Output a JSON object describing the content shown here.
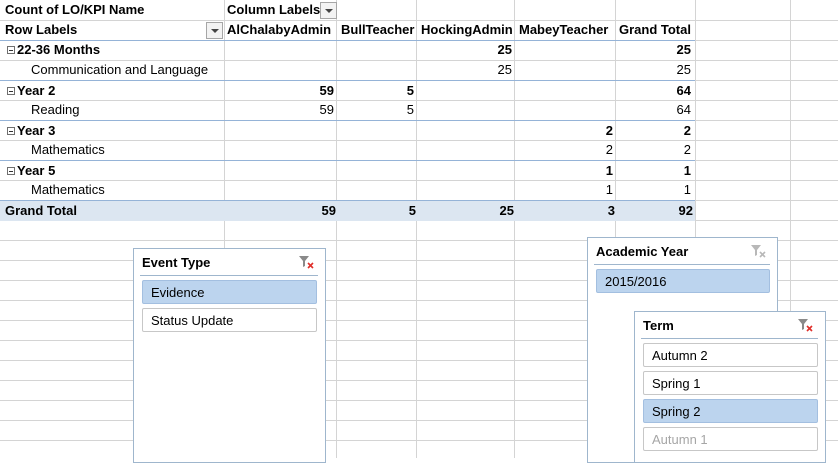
{
  "pivot": {
    "value_header": "Count of LO/KPI Name",
    "column_labels": "Column Labels",
    "row_labels": "Row Labels",
    "columns": [
      "AlChalabyAdmin",
      "BullTeacher",
      "HockingAdmin",
      "MabeyTeacher",
      "Grand Total"
    ],
    "rows": [
      {
        "label": "22-36 Months",
        "level": 0,
        "values": [
          "",
          "",
          "25",
          "",
          "25"
        ]
      },
      {
        "label": "Communication and Language",
        "level": 1,
        "values": [
          "",
          "",
          "25",
          "",
          "25"
        ]
      },
      {
        "label": "Year 2",
        "level": 0,
        "values": [
          "59",
          "5",
          "",
          "",
          "64"
        ]
      },
      {
        "label": "Reading",
        "level": 1,
        "values": [
          "59",
          "5",
          "",
          "",
          "64"
        ]
      },
      {
        "label": "Year 3",
        "level": 0,
        "values": [
          "",
          "",
          "",
          "2",
          "2"
        ]
      },
      {
        "label": "Mathematics",
        "level": 1,
        "values": [
          "",
          "",
          "",
          "2",
          "2"
        ]
      },
      {
        "label": "Year 5",
        "level": 0,
        "values": [
          "",
          "",
          "",
          "1",
          "1"
        ]
      },
      {
        "label": "Mathematics",
        "level": 1,
        "values": [
          "",
          "",
          "",
          "1",
          "1"
        ]
      }
    ],
    "grand_total": {
      "label": "Grand Total",
      "values": [
        "59",
        "5",
        "25",
        "3",
        "92"
      ]
    }
  },
  "slicers": {
    "event_type": {
      "title": "Event Type",
      "items": [
        {
          "label": "Evidence",
          "selected": true
        },
        {
          "label": "Status Update",
          "selected": false
        }
      ]
    },
    "academic_year": {
      "title": "Academic Year",
      "items": [
        {
          "label": "2015/2016",
          "selected": true
        }
      ]
    },
    "term": {
      "title": "Term",
      "items": [
        {
          "label": "Autumn 2",
          "selected": false
        },
        {
          "label": "Spring 1",
          "selected": false
        },
        {
          "label": "Spring 2",
          "selected": true
        },
        {
          "label": "Autumn 1",
          "selected": false,
          "dim": true
        }
      ]
    }
  },
  "icons": {
    "clear_filter": "clear-filter-icon",
    "dropdown": "dropdown-arrow-icon",
    "collapse": "collapse-minus-icon"
  },
  "colors": {
    "pivot_highlight": "#dce6f1",
    "pivot_line": "#95b3d7",
    "slicer_selected": "#bcd4ee",
    "clear_icon_red": "#e0302b"
  }
}
